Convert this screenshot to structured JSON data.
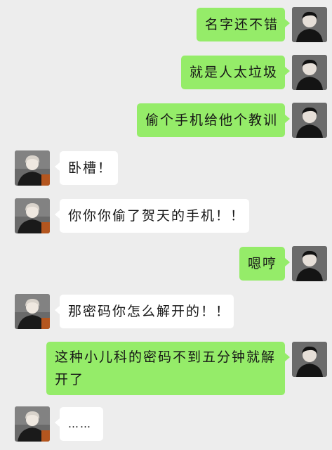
{
  "messages": [
    {
      "side": "out",
      "text": "名字还不错"
    },
    {
      "side": "out",
      "text": "就是人太垃圾"
    },
    {
      "side": "out",
      "text": "偷个手机给他个教训"
    },
    {
      "side": "in",
      "text": "卧槽！"
    },
    {
      "side": "in",
      "text": "你你你偷了贺天的手机！！"
    },
    {
      "side": "out",
      "text": "嗯哼"
    },
    {
      "side": "in",
      "text": "那密码你怎么解开的！！"
    },
    {
      "side": "out",
      "text": "这种小儿科的密码不到五分钟就解开了"
    },
    {
      "side": "in",
      "text": "……"
    }
  ],
  "colors": {
    "background": "#ededed",
    "outgoing_bubble": "#95ec69",
    "incoming_bubble": "#ffffff"
  },
  "avatars": {
    "out": "avatar-dark-haired-man-icon",
    "in": "avatar-light-haired-man-icon"
  }
}
